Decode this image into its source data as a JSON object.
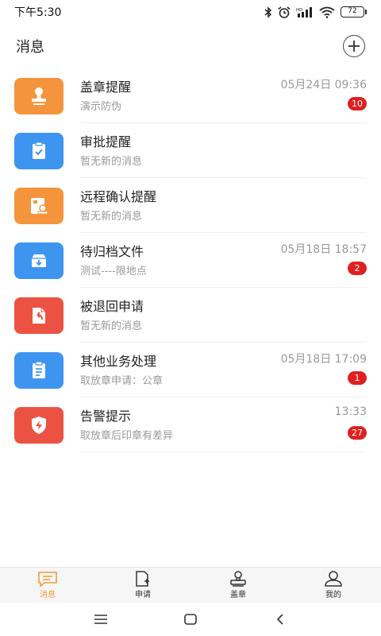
{
  "status_bar": {
    "time": "下午5:30",
    "battery": "72"
  },
  "header": {
    "title": "消息"
  },
  "messages": [
    {
      "name": "盖章提醒",
      "sub": "演示防伪",
      "time": "05月24日 09:36",
      "badge": "10",
      "color": "#f4953d",
      "icon": "stamp-icon"
    },
    {
      "name": "审批提醒",
      "sub": "暂无新的消息",
      "time": "",
      "badge": "",
      "color": "#3e95f0",
      "icon": "clipboard-check-icon"
    },
    {
      "name": "远程确认提醒",
      "sub": "暂无新的消息",
      "time": "",
      "badge": "",
      "color": "#f4953d",
      "icon": "remote-confirm-icon"
    },
    {
      "name": "待归档文件",
      "sub": "测试----限地点",
      "time": "05月18日 18:57",
      "badge": "2",
      "color": "#3e95f0",
      "icon": "archive-icon"
    },
    {
      "name": "被退回申请",
      "sub": "暂无新的消息",
      "time": "",
      "badge": "",
      "color": "#ec5242",
      "icon": "return-document-icon"
    },
    {
      "name": "其他业务处理",
      "sub": "取放章申请：公章",
      "time": "05月18日 17:09",
      "badge": "1",
      "color": "#3e95f0",
      "icon": "clipboard-list-icon"
    },
    {
      "name": "告警提示",
      "sub": "取放章后印章有差异",
      "time": "13:33",
      "badge": "27",
      "color": "#ec5242",
      "icon": "alert-shield-icon"
    }
  ],
  "tabs": [
    {
      "label": "消息",
      "icon": "message-icon",
      "active": true
    },
    {
      "label": "申请",
      "icon": "apply-icon",
      "active": false
    },
    {
      "label": "盖章",
      "icon": "stamp-tab-icon",
      "active": false
    },
    {
      "label": "我的",
      "icon": "profile-icon",
      "active": false
    }
  ],
  "colors": {
    "accent": "#f29b38",
    "badge": "#e02020",
    "orange": "#f4953d",
    "blue": "#3e95f0",
    "red": "#ec5242"
  }
}
